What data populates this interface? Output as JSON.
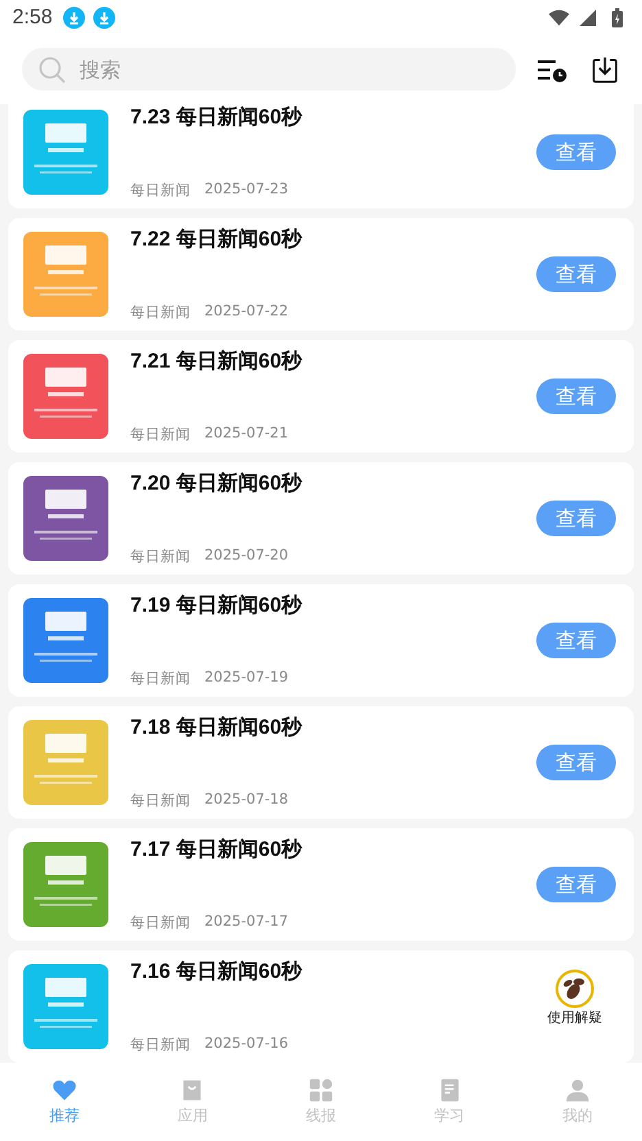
{
  "status_bar": {
    "time": "2:58"
  },
  "search": {
    "placeholder": "搜索"
  },
  "articles": [
    {
      "title": "7.23 每日新闻60秒",
      "source": "每日新闻",
      "date": "2025-07-23",
      "button": "查看",
      "color": "#13c0ea"
    },
    {
      "title": "7.22 每日新闻60秒",
      "source": "每日新闻",
      "date": "2025-07-22",
      "button": "查看",
      "color": "#fbab42"
    },
    {
      "title": "7.21 每日新闻60秒",
      "source": "每日新闻",
      "date": "2025-07-21",
      "button": "查看",
      "color": "#f2525a"
    },
    {
      "title": "7.20 每日新闻60秒",
      "source": "每日新闻",
      "date": "2025-07-20",
      "button": "查看",
      "color": "#7d55a3"
    },
    {
      "title": "7.19 每日新闻60秒",
      "source": "每日新闻",
      "date": "2025-07-19",
      "button": "查看",
      "color": "#2c83ef"
    },
    {
      "title": "7.18 每日新闻60秒",
      "source": "每日新闻",
      "date": "2025-07-18",
      "button": "查看",
      "color": "#e9c646"
    },
    {
      "title": "7.17 每日新闻60秒",
      "source": "每日新闻",
      "date": "2025-07-17",
      "button": "查看",
      "color": "#65ab2f"
    },
    {
      "title": "7.16 每日新闻60秒",
      "source": "每日新闻",
      "date": "2025-07-16",
      "color": "#13c0ea"
    }
  ],
  "help_badge": {
    "label": "使用解疑"
  },
  "nav": [
    {
      "label": "推荐",
      "kind": "heart",
      "selected": true
    },
    {
      "label": "应用",
      "kind": "bag",
      "selected": false
    },
    {
      "label": "线报",
      "kind": "grid",
      "selected": false
    },
    {
      "label": "学习",
      "kind": "book",
      "selected": false
    },
    {
      "label": "我的",
      "kind": "person",
      "selected": false
    }
  ]
}
